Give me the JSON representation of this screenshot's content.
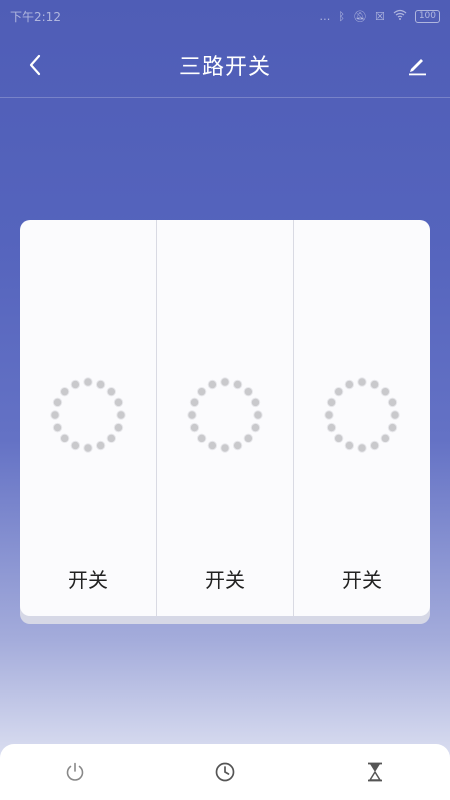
{
  "status_bar": {
    "time": "下午2:12",
    "battery": "100",
    "icons": [
      "dots-icon",
      "bluetooth-icon",
      "mute-icon",
      "sim-icon",
      "wifi-icon",
      "battery-icon"
    ]
  },
  "header": {
    "title": "三路开关",
    "back_icon": "chevron-left-icon",
    "edit_icon": "pencil-icon"
  },
  "switches": [
    {
      "label": "开关",
      "state_icon": "dotted-ring-icon"
    },
    {
      "label": "开关",
      "state_icon": "dotted-ring-icon"
    },
    {
      "label": "开关",
      "state_icon": "dotted-ring-icon"
    }
  ],
  "bottom_nav": [
    {
      "icon": "power-icon"
    },
    {
      "icon": "clock-icon"
    },
    {
      "icon": "hourglass-icon"
    }
  ],
  "colors": {
    "background_top": "#4f5db6",
    "background_bottom": "#eef0f8",
    "panel": "#fbfbfd",
    "icon_gray": "#888888"
  }
}
